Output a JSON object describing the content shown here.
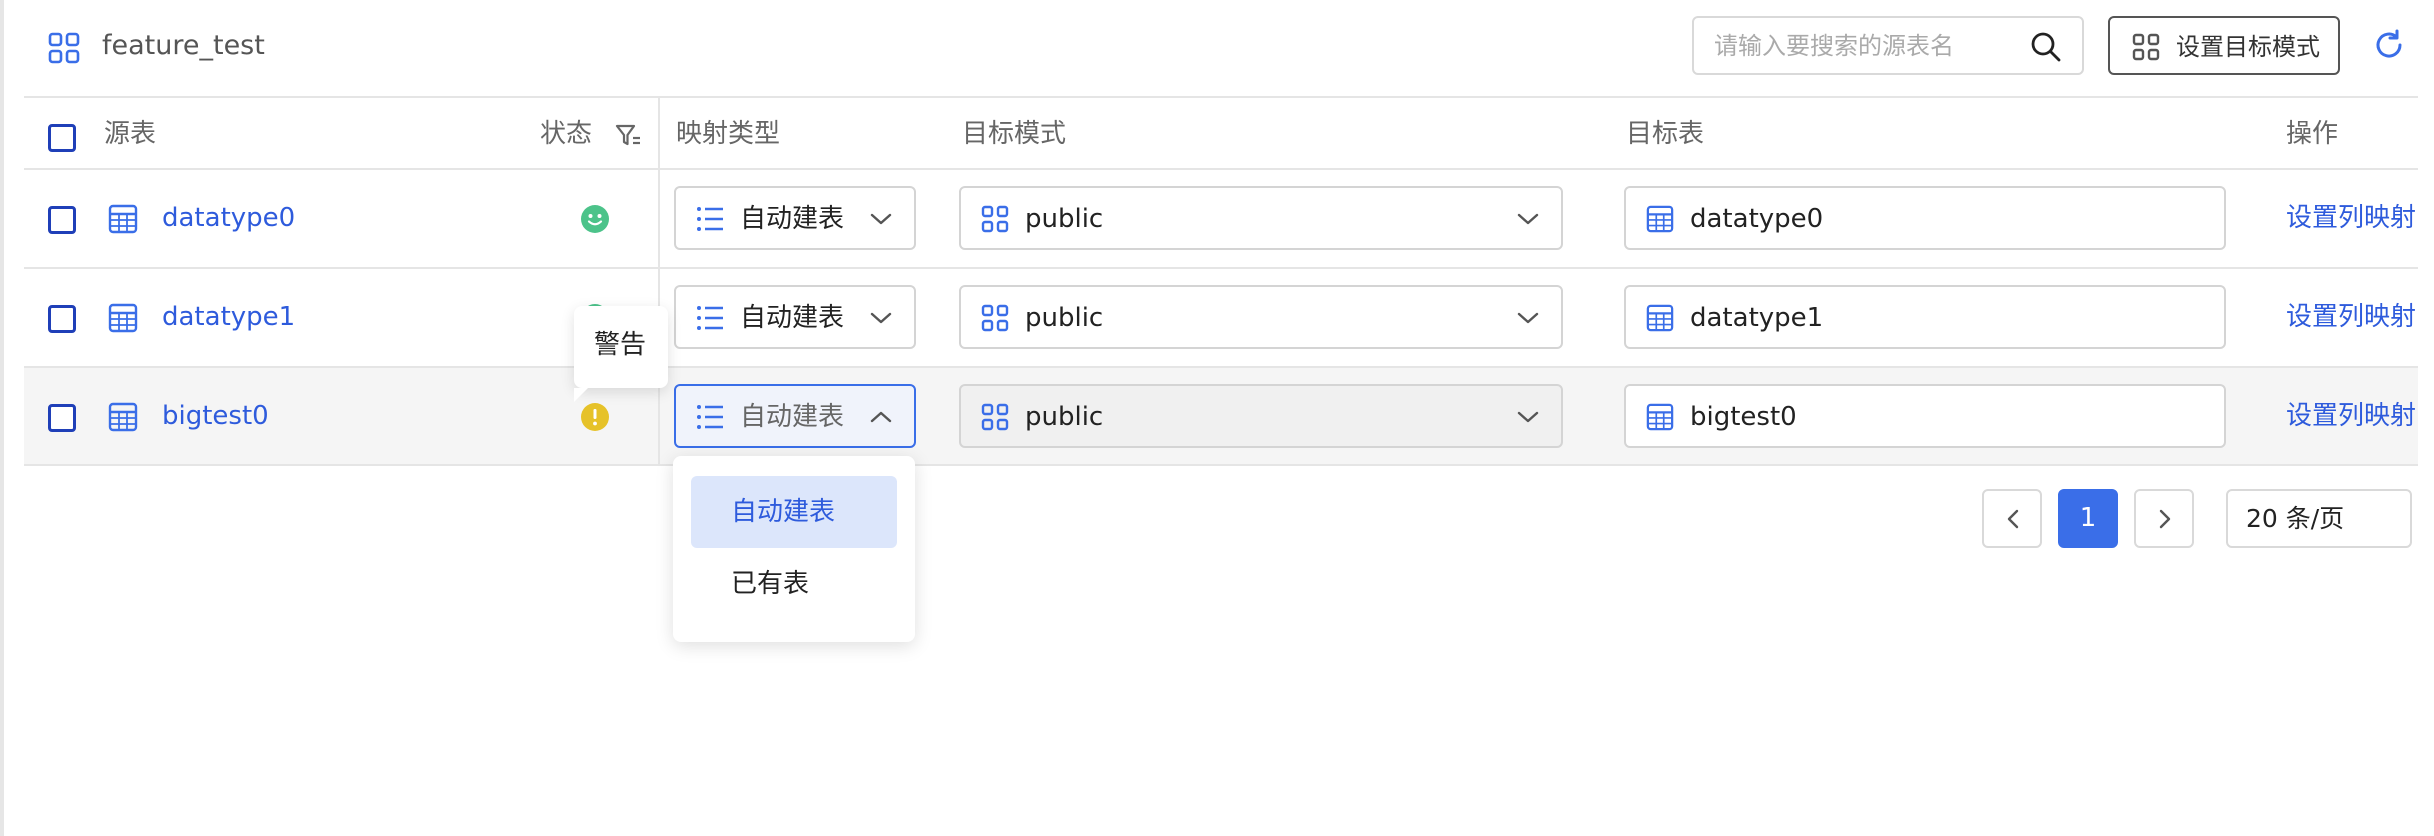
{
  "header": {
    "db_name": "feature_test",
    "search_placeholder": "请输入要搜索的源表名",
    "set_mode_label": "设置目标模式"
  },
  "columns": {
    "source": "源表",
    "status": "状态",
    "mapping_type": "映射类型",
    "target_schema": "目标模式",
    "target_table": "目标表",
    "action": "操作"
  },
  "rows": [
    {
      "source": "datatype0",
      "status": "ok",
      "mapping_type": "自动建表",
      "target_schema": "public",
      "target_table": "datatype0",
      "action": "设置列映射"
    },
    {
      "source": "datatype1",
      "status": "ok",
      "mapping_type": "自动建表",
      "target_schema": "public",
      "target_table": "datatype1",
      "action": "设置列映射"
    },
    {
      "source": "bigtest0",
      "status": "warning",
      "mapping_type": "自动建表",
      "target_schema": "public",
      "target_table": "bigtest0",
      "action": "设置列映射"
    }
  ],
  "tooltip": {
    "text": "警告"
  },
  "dropdown": {
    "options": [
      "自动建表",
      "已有表"
    ],
    "selected": "自动建表"
  },
  "pagination": {
    "current_page": "1",
    "page_size": "20 条/页"
  },
  "colors": {
    "accent": "#3a6ee8",
    "link": "#2e5bdc",
    "ok": "#4cc38a",
    "warning": "#e6c229"
  }
}
